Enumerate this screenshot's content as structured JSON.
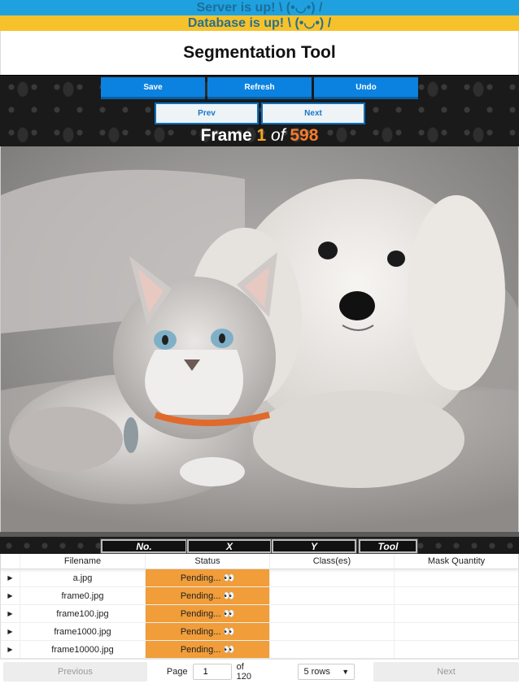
{
  "status": {
    "server": "Server is up! \\ (•◡•) /",
    "database": "Database is up! \\ (•◡•) /"
  },
  "app": {
    "title": "Segmentation Tool"
  },
  "toolbar": {
    "save": "Save",
    "refresh": "Refresh",
    "undo": "Undo",
    "prev": "Prev",
    "next": "Next"
  },
  "frame": {
    "prefix": "Frame",
    "current": "1",
    "of": "of",
    "total": "598"
  },
  "annotation_header": {
    "no": "No.",
    "x": "X",
    "y": "Y",
    "tool": "Tool"
  },
  "table": {
    "columns": [
      "Filename",
      "Status",
      "Class(es)",
      "Mask Quantity"
    ],
    "rows": [
      {
        "filename": "a.jpg",
        "status": "Pending... 👀",
        "classes": "",
        "mask_quantity": ""
      },
      {
        "filename": "frame0.jpg",
        "status": "Pending... 👀",
        "classes": "",
        "mask_quantity": ""
      },
      {
        "filename": "frame100.jpg",
        "status": "Pending... 👀",
        "classes": "",
        "mask_quantity": ""
      },
      {
        "filename": "frame1000.jpg",
        "status": "Pending... 👀",
        "classes": "",
        "mask_quantity": ""
      },
      {
        "filename": "frame10000.jpg",
        "status": "Pending... 👀",
        "classes": "",
        "mask_quantity": ""
      }
    ],
    "expand_glyph": "▶"
  },
  "pagination": {
    "previous": "Previous",
    "page_label": "Page",
    "page_value": "1",
    "of_pages": "of 120",
    "rows_option": "5 rows",
    "next": "Next"
  },
  "colors": {
    "server_banner": "#1fa1e0",
    "db_banner": "#f6c22b",
    "primary_button": "#0b82e0",
    "pending_status": "#f09d3a",
    "frame_current": "#f5a623",
    "frame_total": "#f57c2a"
  }
}
